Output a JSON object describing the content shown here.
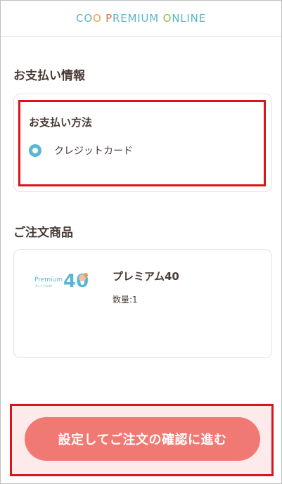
{
  "header": {
    "logo_text": "COO PREMIUM ONLINE"
  },
  "payment_section": {
    "title": "お支払い情報",
    "method_title": "お支払い方法",
    "options": [
      {
        "label": "クレジットカード",
        "selected": true
      }
    ]
  },
  "order_section": {
    "title": "ご注文商品",
    "product": {
      "name": "プレミアム40",
      "quantity": "数量:1",
      "image_text": "Premium",
      "image_number": "40",
      "image_subtext": "プレミアム40"
    }
  },
  "cta": {
    "label": "設定してご注文の確認に進む"
  },
  "colors": {
    "accent_blue": "#5bb6d6",
    "cta_coral": "#f07a73",
    "highlight_red": "#d9141d"
  }
}
